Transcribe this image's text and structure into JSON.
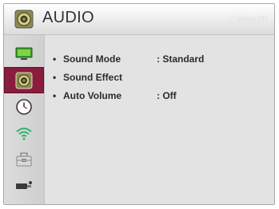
{
  "header": {
    "title": "AUDIO",
    "hint": "Move  OK",
    "icon": "speaker-icon"
  },
  "sidebar": {
    "items": [
      {
        "name": "picture",
        "icon": "tv-icon",
        "active": false
      },
      {
        "name": "audio",
        "icon": "speaker-icon",
        "active": true
      },
      {
        "name": "time",
        "icon": "clock-icon",
        "active": false
      },
      {
        "name": "network",
        "icon": "wifi-icon",
        "active": false
      },
      {
        "name": "setup",
        "icon": "toolbox-icon",
        "active": false
      },
      {
        "name": "input",
        "icon": "input-plug-icon",
        "active": false
      }
    ]
  },
  "menu": {
    "items": [
      {
        "label": "Sound Mode",
        "value": ": Standard"
      },
      {
        "label": "Sound Effect",
        "value": ""
      },
      {
        "label": "Auto Volume",
        "value": ": Off"
      }
    ]
  },
  "colors": {
    "active_nav": "#8a1c3e",
    "panel_bg": "#e3e3e3",
    "text": "#2b2b2b"
  }
}
